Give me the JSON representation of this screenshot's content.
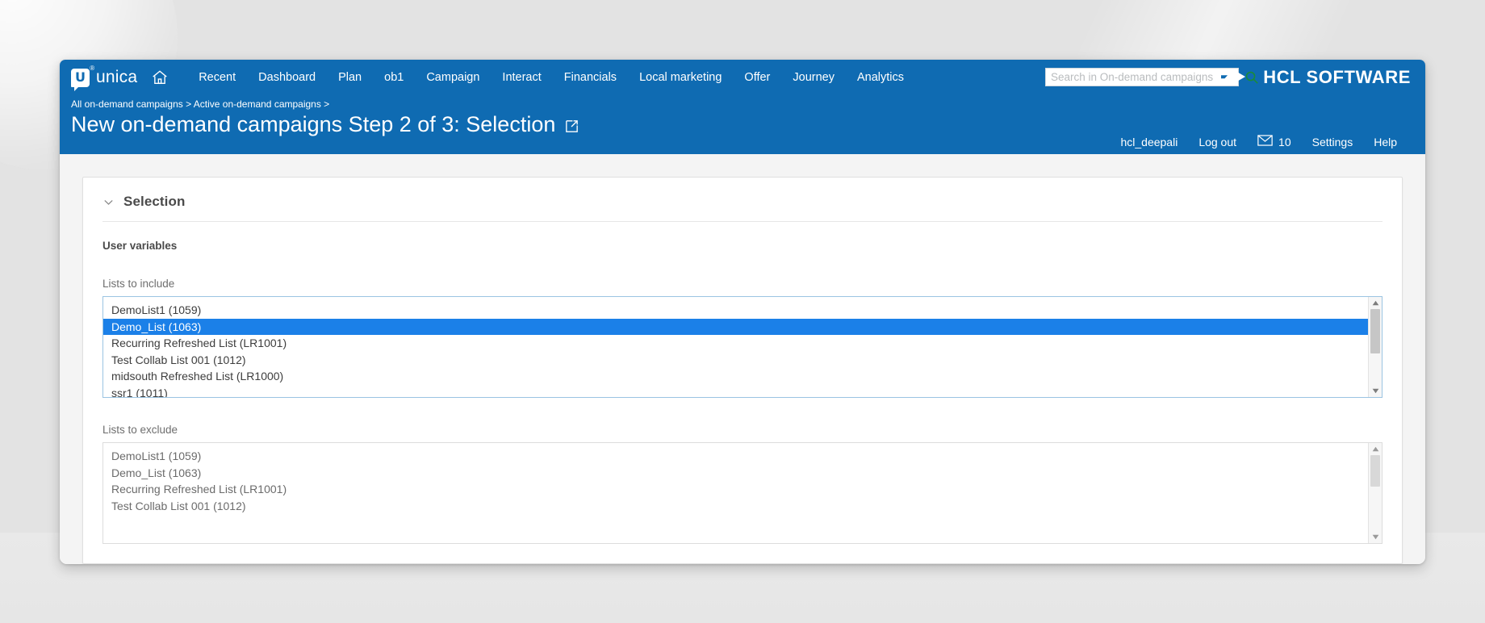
{
  "brand": {
    "mark_letter": "U",
    "registered": "®",
    "name": "unica",
    "home_icon": "home-icon"
  },
  "nav": {
    "links": [
      {
        "label": "Recent"
      },
      {
        "label": "Dashboard"
      },
      {
        "label": "Plan"
      },
      {
        "label": "ob1"
      },
      {
        "label": "Campaign"
      },
      {
        "label": "Interact"
      },
      {
        "label": "Financials"
      },
      {
        "label": "Local marketing"
      },
      {
        "label": "Offer"
      },
      {
        "label": "Journey"
      },
      {
        "label": "Analytics"
      }
    ]
  },
  "search": {
    "placeholder": "Search in On-demand campaigns",
    "value": "",
    "icon": "search-icon",
    "icon_color": "#1a8a3c"
  },
  "corp_logo": {
    "text": "HCL SOFTWARE",
    "mark": "hcl-arrow-icon"
  },
  "header": {
    "breadcrumb": "All on-demand campaigns > Active on-demand campaigns >",
    "title": "New on-demand campaigns Step 2 of 3: Selection",
    "external_link_icon": "external-link-icon",
    "user": "hcl_deepali",
    "logout_label": "Log out",
    "mail_icon": "envelope-icon",
    "mail_count": "10",
    "settings_label": "Settings",
    "help_label": "Help"
  },
  "section": {
    "collapse_icon": "chevron-down-icon",
    "title": "Selection",
    "subsection_title": "User variables"
  },
  "lists_to_include": {
    "label": "Lists to include",
    "options": [
      {
        "label": "DemoList1 (1059)",
        "selected": false
      },
      {
        "label": "Demo_List (1063)",
        "selected": true
      },
      {
        "label": "Recurring Refreshed List (LR1001)",
        "selected": false
      },
      {
        "label": "Test Collab List 001 (1012)",
        "selected": false
      },
      {
        "label": "midsouth Refreshed List (LR1000)",
        "selected": false
      },
      {
        "label": "ssr1 (1011)",
        "selected": false
      }
    ],
    "scrollbar": {
      "up_arrow": "scroll-up-arrow-icon",
      "down_arrow": "scroll-down-arrow-icon"
    }
  },
  "lists_to_exclude": {
    "label": "Lists to exclude",
    "options": [
      {
        "label": "DemoList1 (1059)",
        "selected": false
      },
      {
        "label": "Demo_List (1063)",
        "selected": false
      },
      {
        "label": "Recurring Refreshed List (LR1001)",
        "selected": false
      },
      {
        "label": "Test Collab List 001 (1012)",
        "selected": false
      }
    ],
    "scrollbar": {
      "up_arrow": "scroll-up-arrow-icon",
      "down_arrow": "scroll-down-arrow-icon"
    }
  },
  "colors": {
    "brand_blue": "#0f6bb2",
    "selection_blue": "#1b80e8",
    "focus_border": "#9bc4e2"
  }
}
